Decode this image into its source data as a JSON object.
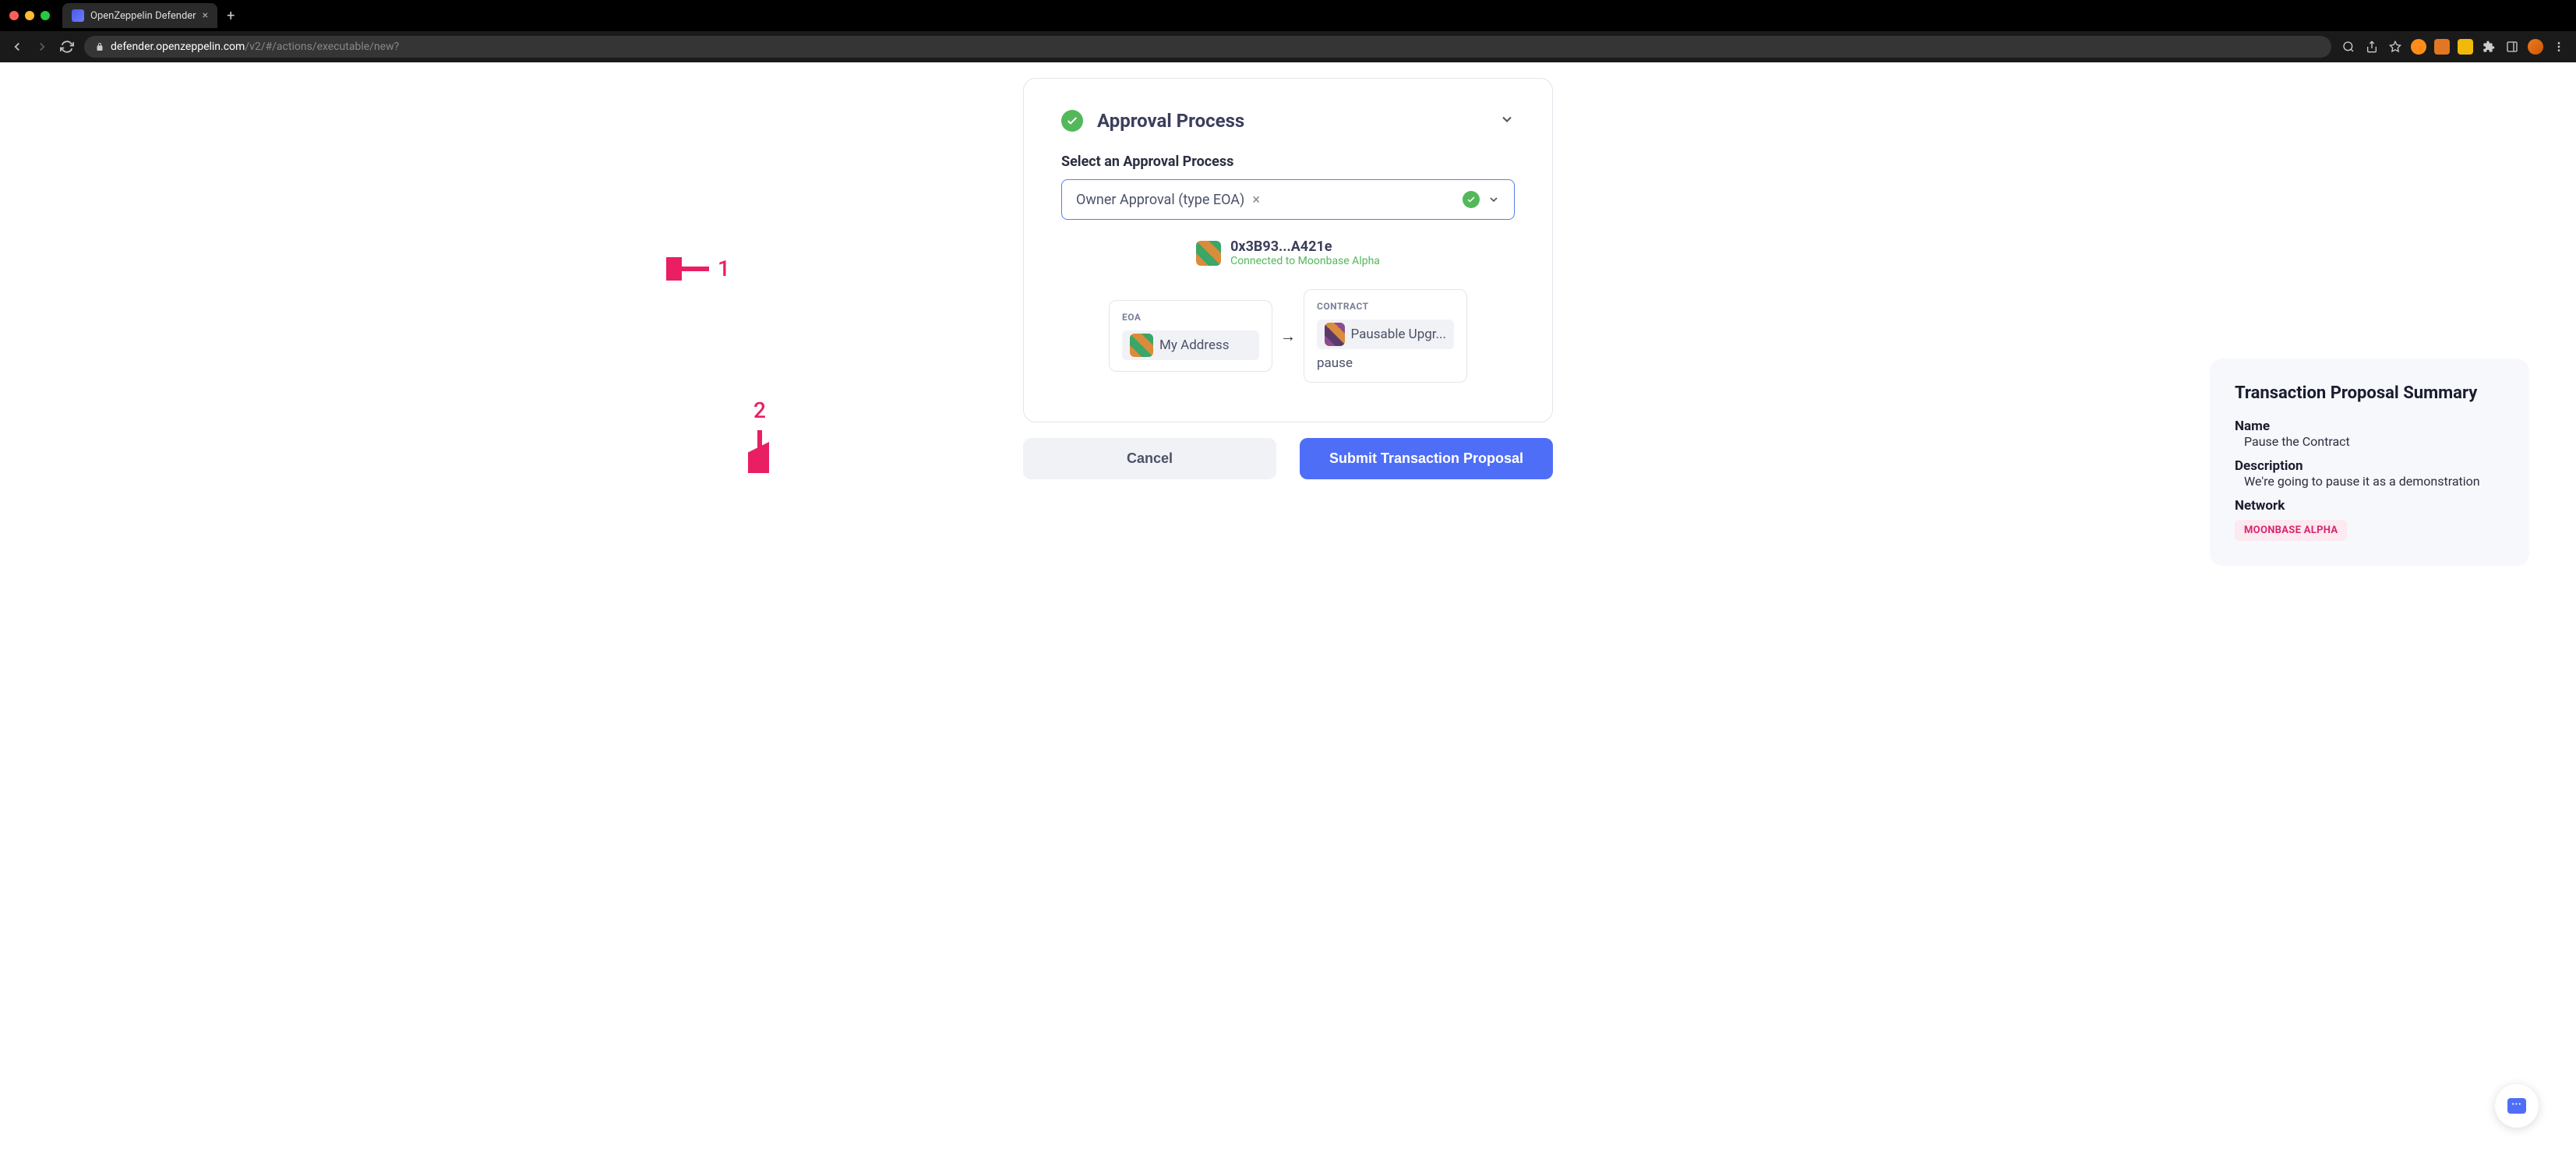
{
  "browser": {
    "tab_title": "OpenZeppelin Defender",
    "url_domain": "defender.openzeppelin.com",
    "url_path": "/v2/#/actions/executable/new?"
  },
  "section": {
    "title": "Approval Process",
    "field_label": "Select an Approval Process",
    "selected_value": "Owner Approval (type EOA)"
  },
  "wallet": {
    "address": "0x3B93...A421e",
    "status": "Connected to Moonbase Alpha"
  },
  "flow": {
    "eoa_label": "EOA",
    "eoa_name": "My Address",
    "contract_label": "CONTRACT",
    "contract_name": "Pausable Upgr...",
    "method": "pause"
  },
  "buttons": {
    "cancel": "Cancel",
    "submit": "Submit Transaction Proposal"
  },
  "summary": {
    "title": "Transaction Proposal Summary",
    "name_label": "Name",
    "name_value": "Pause the Contract",
    "description_label": "Description",
    "description_value": "We're going to pause it as a demonstration",
    "network_label": "Network",
    "network_value": "MOONBASE ALPHA"
  },
  "annotations": {
    "one": "1",
    "two": "2"
  }
}
